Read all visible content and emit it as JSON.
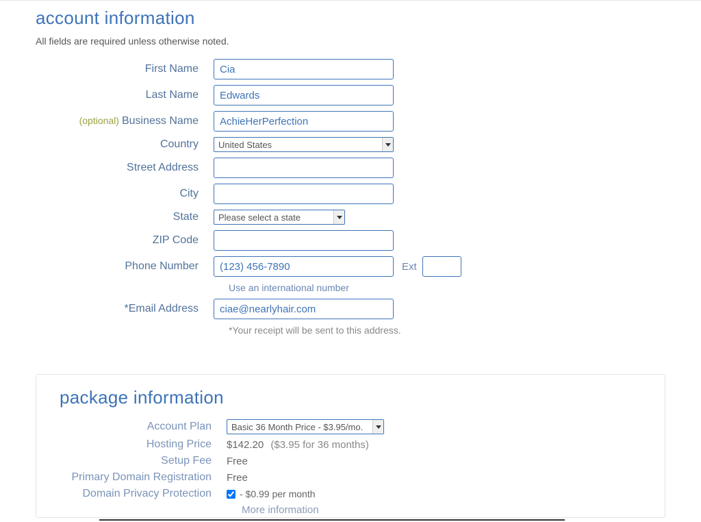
{
  "account": {
    "title": "account information",
    "subtitle": "All fields are required unless otherwise noted.",
    "labels": {
      "first_name": "First Name",
      "last_name": "Last Name",
      "business_name": "Business Name",
      "business_optional": "(optional)",
      "country": "Country",
      "street": "Street Address",
      "city": "City",
      "state": "State",
      "zip": "ZIP Code",
      "phone": "Phone Number",
      "ext": "Ext",
      "email": "*Email Address"
    },
    "values": {
      "first_name": "Cia",
      "last_name": "Edwards",
      "business_name": "AchieHerPerfection",
      "country": "United States",
      "street": "",
      "city": "",
      "state": "Please select a state",
      "zip": "",
      "phone": "(123) 456-7890",
      "ext": "",
      "email": "ciae@nearlyhair.com"
    },
    "intl_link": "Use an international number",
    "email_hint": "*Your receipt will be sent to this address."
  },
  "package": {
    "title": "package information",
    "labels": {
      "account_plan": "Account Plan",
      "hosting_price": "Hosting Price",
      "setup_fee": "Setup Fee",
      "primary_domain": "Primary Domain Registration",
      "privacy": "Domain Privacy Protection"
    },
    "values": {
      "account_plan": "Basic 36 Month Price - $3.95/mo.",
      "hosting_price_main": "$142.20",
      "hosting_price_detail": "($3.95 for 36 months)",
      "setup_fee": "Free",
      "primary_domain": "Free",
      "privacy_text": " - $0.99 per month",
      "privacy_checked": true
    },
    "more_link": "More information"
  }
}
